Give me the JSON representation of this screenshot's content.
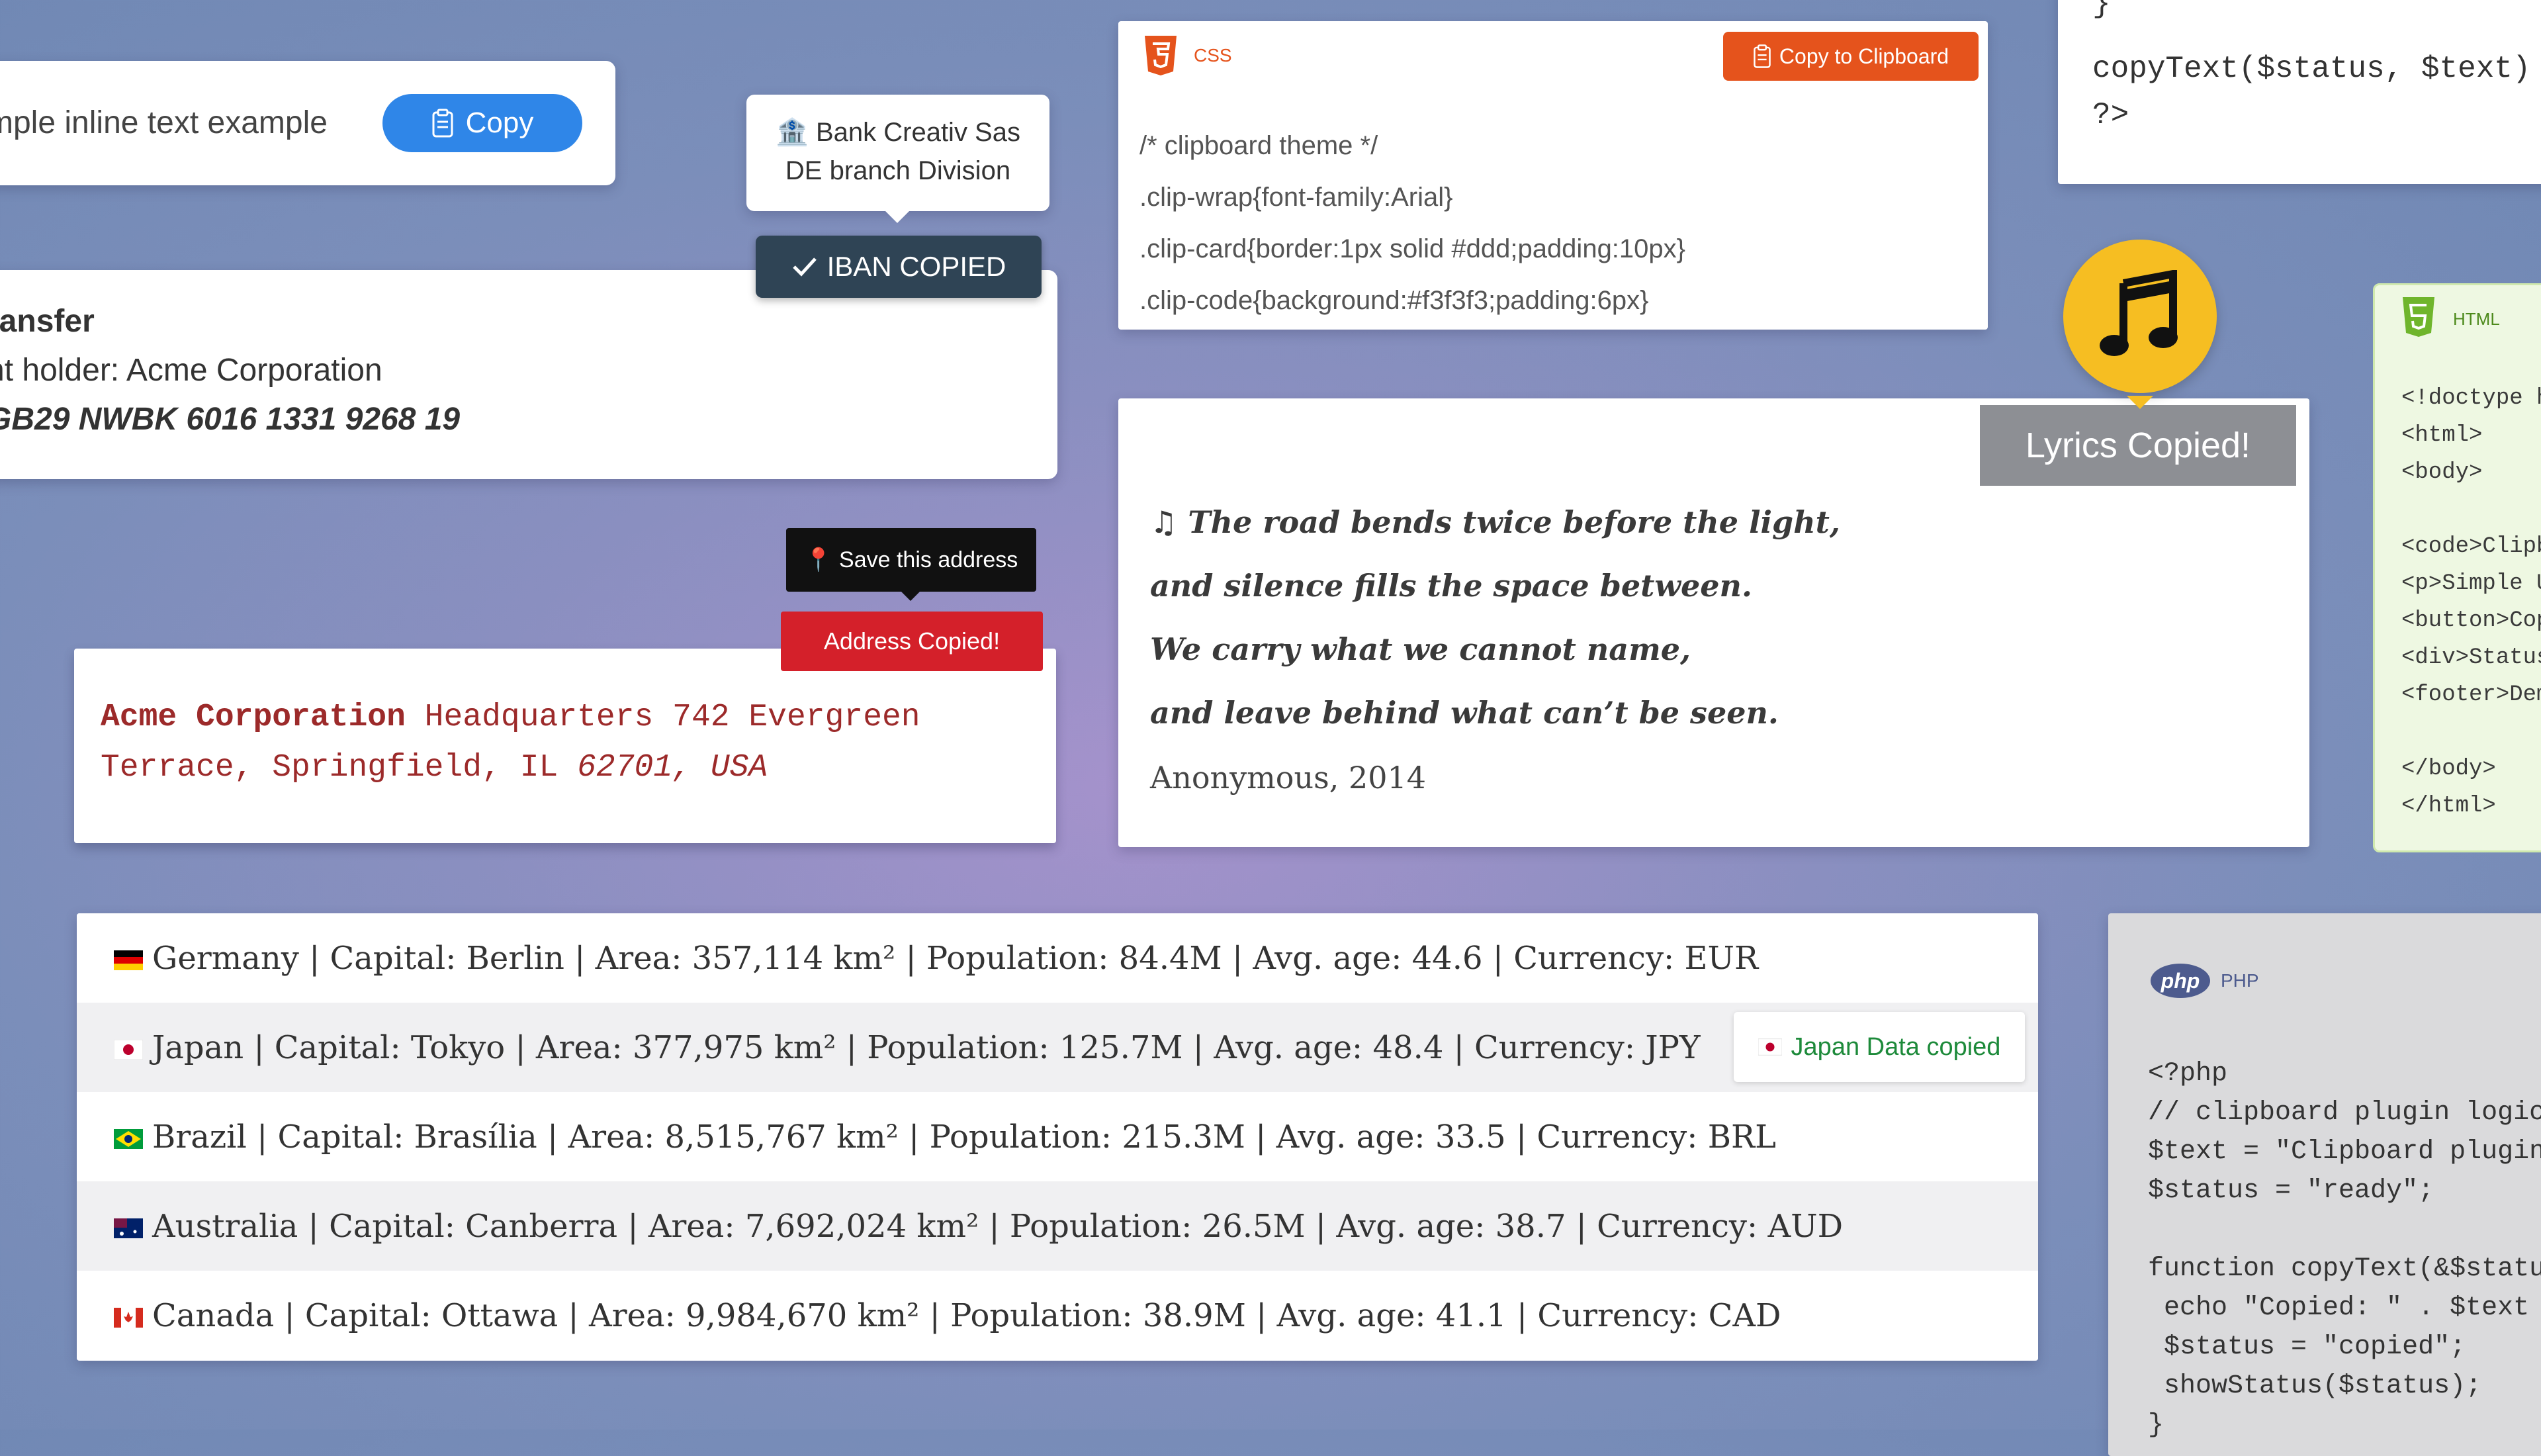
{
  "inline": {
    "text": "mple inline text example",
    "copy_label": "Copy"
  },
  "bank_tip": {
    "line1": "Bank Creativ Sas",
    "line2": "DE branch Division"
  },
  "iban_badge": "IBAN COPIED",
  "transfer": {
    "heading": "ransfer",
    "holder": "nt holder: Acme Corporation",
    "iban": "GB29 NWBK 6016 1331 9268 19"
  },
  "address": {
    "save_tip": "Save this address",
    "badge": "Address Copied!",
    "company": "Acme Corporation",
    "line_a": " Headquarters 742 Evergreen",
    "line_b": "Terrace, Springfield, IL ",
    "line_c": "62701, USA"
  },
  "css_card": {
    "tag": "CSS",
    "copy_label": "Copy to Clipboard",
    "lines": [
      "/* clipboard theme */",
      ".clip-wrap{font-family:Arial}",
      ".clip-card{border:1px solid #ddd;padding:10px}",
      ".clip-code{background:#f3f3f3;padding:6px}"
    ]
  },
  "php_top": {
    "brace": "}",
    "lines": [
      "copyText($status, $text)",
      "?>"
    ]
  },
  "lyrics": {
    "badge": "Lyrics Copied!",
    "lines": [
      "The road bends twice before the light,",
      "and silence fills the space between.",
      "We carry what we cannot name,",
      "and leave behind what can’t be seen."
    ],
    "attribution": "Anonymous, 2014"
  },
  "html_card": {
    "tag": "HTML",
    "lines": [
      "<!doctype h",
      "<html>",
      "<body>",
      "",
      "<code>Clipb",
      "<p>Simple U",
      "<button>Cop",
      "<div>Status",
      "<footer>Dem",
      "",
      "</body>",
      "</html>"
    ]
  },
  "countries": [
    {
      "text": "Germany | Capital: Berlin | Area: 357,114 km² | Population: 84.4M | Avg. age: 44.6 | Currency: EUR",
      "flag": "de"
    },
    {
      "text": "Japan | Capital: Tokyo | Area: 377,975 km² | Population: 125.7M | Avg. age: 48.4 | Currency: JPY",
      "flag": "jp"
    },
    {
      "text": "Brazil | Capital: Brasília | Area: 8,515,767 km² | Population: 215.3M | Avg. age: 33.5 | Currency: BRL",
      "flag": "br"
    },
    {
      "text": "Australia | Capital: Canberra | Area: 7,692,024 km² | Population: 26.5M | Avg. age: 38.7 | Currency: AUD",
      "flag": "au"
    },
    {
      "text": "Canada | Capital: Ottawa | Area: 9,984,670 km² | Population: 38.9M | Avg. age: 41.1 | Currency: CAD",
      "flag": "ca"
    }
  ],
  "japan_badge": "Japan Data copied",
  "php_card": {
    "logo": "php",
    "tag": "PHP",
    "lines": [
      "<?php",
      "// clipboard plugin logic",
      "$text = \"Clipboard plugin",
      "$status = \"ready\";",
      "",
      "function copyText(&$status",
      " echo \"Copied: \" . $text .",
      " $status = \"copied\";",
      " showStatus($status);",
      "}"
    ]
  },
  "colors": {
    "blue": "#2f86e8",
    "orange": "#e5531c",
    "red": "#d4202a",
    "yellow": "#f6be22",
    "green": "#1d8a3a"
  }
}
